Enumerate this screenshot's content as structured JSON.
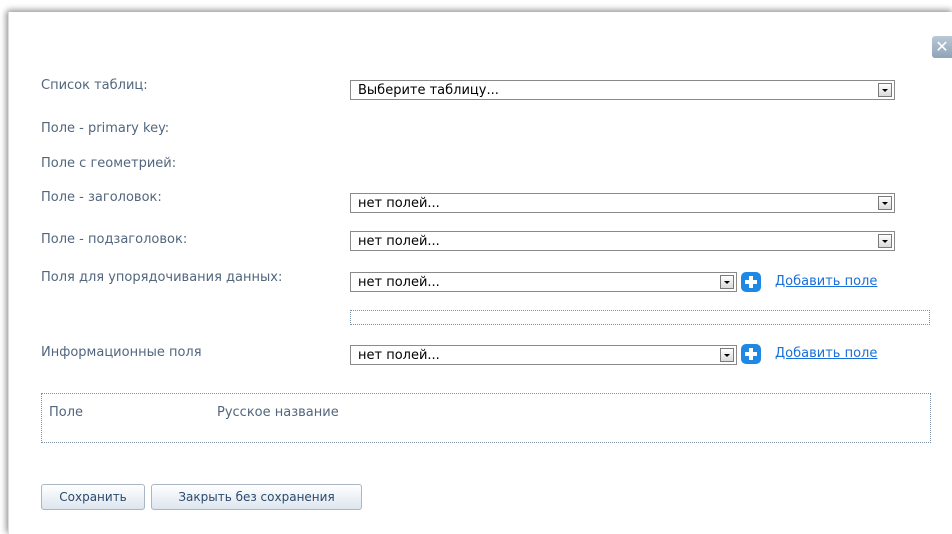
{
  "dialog": {
    "close_label": "✕",
    "fields": {
      "table_list_label": "Список таблиц:",
      "primary_key_label": "Поле - primary key:",
      "geometry_label": "Поле с геометрией:",
      "title_label": "Поле - заголовок:",
      "subtitle_label": "Поле - подзаголовок:",
      "sort_label": "Поля для упорядочивания данных:",
      "info_label": "Информационные поля"
    },
    "selects": {
      "table": "Выберите таблицу...",
      "title": "нет полей...",
      "subtitle": "нет полей...",
      "sort": "нет полей...",
      "info": "нет полей..."
    },
    "add_field_link": "Добавить поле",
    "info_table": {
      "columns": [
        "Поле",
        "Русское название"
      ]
    },
    "buttons": {
      "save": "Сохранить",
      "close_without_save": "Закрыть без сохранения"
    }
  },
  "colors": {
    "label": "#52667d",
    "link": "#1a6fd8",
    "add_icon": "#1e88e5"
  }
}
